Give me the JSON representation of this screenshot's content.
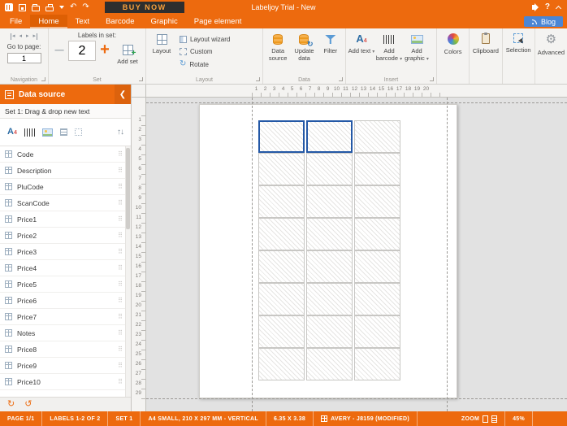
{
  "titlebar": {
    "title": "Labeljoy Trial - New",
    "buy_now_label": "BUY NOW"
  },
  "menu": {
    "tabs": [
      "File",
      "Home",
      "Text",
      "Barcode",
      "Graphic",
      "Page element"
    ],
    "active_tab": "Home",
    "blog_label": "Blog"
  },
  "ribbon": {
    "navigation": {
      "go_to_page_label": "Go to page:",
      "page_value": "1",
      "group_label": "Navigation"
    },
    "set": {
      "labels_in_set_label": "Labels in set:",
      "value": "2",
      "minus": "–",
      "plus": "+",
      "add_set_label": "Add set",
      "group_label": "Set"
    },
    "layout": {
      "layout_label": "Layout",
      "wizard_label": "Layout wizard",
      "custom_label": "Custom",
      "rotate_label": "Rotate",
      "group_label": "Layout"
    },
    "data": {
      "source_label": "Data source",
      "update_label": "Update data",
      "filter_label": "Filter",
      "group_label": "Data"
    },
    "insert": {
      "text_label": "Add text",
      "barcode_label": "Add barcode",
      "graphic_label": "Add graphic",
      "group_label": "Insert"
    },
    "tools": [
      "Colors",
      "Clipboard",
      "Selection",
      "Advanced"
    ]
  },
  "sidebar": {
    "header_label": "Data source",
    "set_hint": "Set 1: Drag & drop new text",
    "fields": [
      "Code",
      "Description",
      "PluCode",
      "ScanCode",
      "Price1",
      "Price2",
      "Price3",
      "Price4",
      "Price5",
      "Price6",
      "Price7",
      "Notes",
      "Price8",
      "Price9",
      "Price10"
    ]
  },
  "canvas": {
    "h_ruler_max": 20,
    "v_ruler_max": 29,
    "grid_cols": 3,
    "grid_rows": 8,
    "selected_cells": [
      0,
      1
    ]
  },
  "statusbar": {
    "page": "PAGE 1/1",
    "labels": "LABELS 1-2 OF 2",
    "set": "SET 1",
    "format": "A4 SMALL, 210 X 297 MM - VERTICAL",
    "size": "6.35 X 3.38",
    "template": "AVERY - J8159 (MODIFIED)",
    "zoom_label": "ZOOM",
    "zoom_value": "45%"
  },
  "colors": {
    "accent_orange": "#ED6A0E",
    "selection_blue": "#2458A6",
    "blog_blue": "#4B86D5"
  }
}
